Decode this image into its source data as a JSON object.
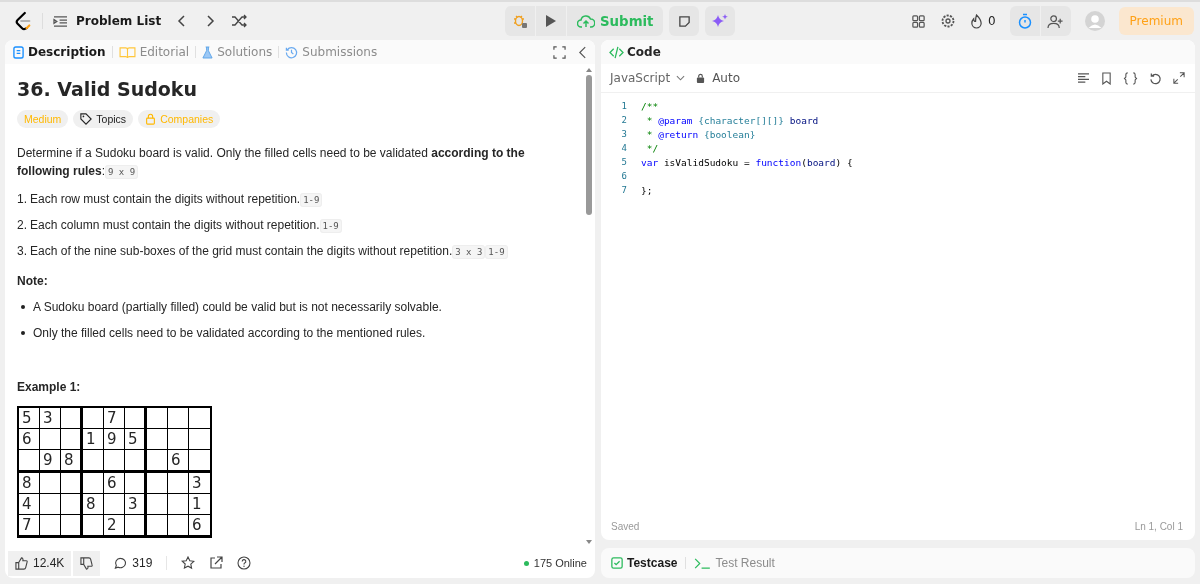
{
  "nav": {
    "problem_list": "Problem List",
    "submit": "Submit",
    "streak": "0",
    "premium": "Premium"
  },
  "left_tabs": [
    {
      "label": "Description",
      "selected": true,
      "kind": "description"
    },
    {
      "label": "Editorial",
      "selected": false,
      "kind": "editorial"
    },
    {
      "label": "Solutions",
      "selected": false,
      "kind": "solutions"
    },
    {
      "label": "Submissions",
      "selected": false,
      "kind": "submissions"
    }
  ],
  "problem": {
    "title": "36. Valid Sudoku",
    "tags": [
      {
        "label": "Medium",
        "kind": "difficulty"
      },
      {
        "label": "Topics",
        "kind": "topics"
      },
      {
        "label": "Companies",
        "kind": "companies"
      }
    ],
    "intro": [
      {
        "kind": "text",
        "text": "Determine if a  Sudoku board is valid. Only the filled cells need to be validated **according to the following rules**:"
      },
      {
        "kind": "code",
        "text": "9 x 9"
      }
    ],
    "rules": [
      {
        "number": "1.",
        "segments": [
          {
            "kind": "text",
            "text": "Each row must contain the digits  without repetition."
          },
          {
            "kind": "code",
            "text": "1-9"
          }
        ]
      },
      {
        "number": "2.",
        "segments": [
          {
            "kind": "text",
            "text": "Each column must contain the digits  without repetition."
          },
          {
            "kind": "code",
            "text": "1-9"
          }
        ]
      },
      {
        "number": "3.",
        "segments": [
          {
            "kind": "text",
            "text": "Each of the nine  sub-boxes of the grid must contain the digits  without repetition."
          },
          {
            "kind": "code",
            "text": "3 x 3"
          },
          {
            "kind": "code",
            "text": "1-9"
          }
        ]
      }
    ],
    "note_label": "Note:",
    "notes": [
      "A Sudoku board (partially filled) could be valid but is not necessarily solvable.",
      "Only the filled cells need to be validated according to the mentioned rules."
    ],
    "example_label": "Example 1:",
    "board": [
      [
        {
          "kind": "digit",
          "value": "5"
        },
        {
          "kind": "digit",
          "value": "3"
        },
        {
          "kind": "blank"
        },
        {
          "kind": "blank"
        },
        {
          "kind": "digit",
          "value": "7"
        },
        {
          "kind": "blank"
        },
        {
          "kind": "blank"
        },
        {
          "kind": "blank"
        },
        {
          "kind": "blank"
        }
      ],
      [
        {
          "kind": "digit",
          "value": "6"
        },
        {
          "kind": "blank"
        },
        {
          "kind": "blank"
        },
        {
          "kind": "digit",
          "value": "1"
        },
        {
          "kind": "digit",
          "value": "9"
        },
        {
          "kind": "digit",
          "value": "5"
        },
        {
          "kind": "blank"
        },
        {
          "kind": "blank"
        },
        {
          "kind": "blank"
        }
      ],
      [
        {
          "kind": "blank"
        },
        {
          "kind": "digit",
          "value": "9"
        },
        {
          "kind": "digit",
          "value": "8"
        },
        {
          "kind": "blank"
        },
        {
          "kind": "blank"
        },
        {
          "kind": "blank"
        },
        {
          "kind": "blank"
        },
        {
          "kind": "digit",
          "value": "6"
        },
        {
          "kind": "blank"
        }
      ],
      [
        {
          "kind": "digit",
          "value": "8"
        },
        {
          "kind": "blank"
        },
        {
          "kind": "blank"
        },
        {
          "kind": "blank"
        },
        {
          "kind": "digit",
          "value": "6"
        },
        {
          "kind": "blank"
        },
        {
          "kind": "blank"
        },
        {
          "kind": "blank"
        },
        {
          "kind": "digit",
          "value": "3"
        }
      ],
      [
        {
          "kind": "digit",
          "value": "4"
        },
        {
          "kind": "blank"
        },
        {
          "kind": "blank"
        },
        {
          "kind": "digit",
          "value": "8"
        },
        {
          "kind": "blank"
        },
        {
          "kind": "digit",
          "value": "3"
        },
        {
          "kind": "blank"
        },
        {
          "kind": "blank"
        },
        {
          "kind": "digit",
          "value": "1"
        }
      ],
      [
        {
          "kind": "digit",
          "value": "7"
        },
        {
          "kind": "blank"
        },
        {
          "kind": "blank"
        },
        {
          "kind": "blank"
        },
        {
          "kind": "digit",
          "value": "2"
        },
        {
          "kind": "blank"
        },
        {
          "kind": "blank"
        },
        {
          "kind": "blank"
        },
        {
          "kind": "digit",
          "value": "6"
        }
      ]
    ]
  },
  "footer": {
    "likes": "12.4K",
    "comments": "319",
    "online": "175 Online"
  },
  "code_panel": {
    "title": "Code",
    "language": "JavaScript",
    "mode": "Auto",
    "lines": [
      {
        "number": "1",
        "tokens": [
          {
            "kind": "comment",
            "text": "/**"
          }
        ]
      },
      {
        "number": "2",
        "tokens": [
          {
            "kind": "comment",
            "text": " * "
          },
          {
            "kind": "keyword",
            "text": "@param"
          },
          {
            "kind": "type",
            "text": " {character[][]}"
          },
          {
            "kind": "ident",
            "text": " board"
          }
        ]
      },
      {
        "number": "3",
        "tokens": [
          {
            "kind": "comment",
            "text": " * "
          },
          {
            "kind": "keyword",
            "text": "@return"
          },
          {
            "kind": "type",
            "text": " {boolean}"
          }
        ]
      },
      {
        "number": "4",
        "tokens": [
          {
            "kind": "comment",
            "text": " */"
          }
        ]
      },
      {
        "number": "5",
        "tokens": [
          {
            "kind": "keyword",
            "text": "var"
          },
          {
            "kind": "plain",
            "text": " isValidSudoku = "
          },
          {
            "kind": "keyword",
            "text": "function"
          },
          {
            "kind": "plain",
            "text": "("
          },
          {
            "kind": "ident",
            "text": "board"
          },
          {
            "kind": "plain",
            "text": ") {"
          }
        ]
      },
      {
        "number": "6"
      },
      {
        "number": "7",
        "tokens": [
          {
            "kind": "plain",
            "text": "};"
          }
        ]
      }
    ],
    "status": "Saved",
    "cursor": "Ln 1, Col 1"
  },
  "bottom_tabs": [
    {
      "label": "Testcase",
      "selected": true,
      "kind": "testcase"
    },
    {
      "label": "Test Result",
      "selected": false,
      "kind": "result"
    }
  ]
}
